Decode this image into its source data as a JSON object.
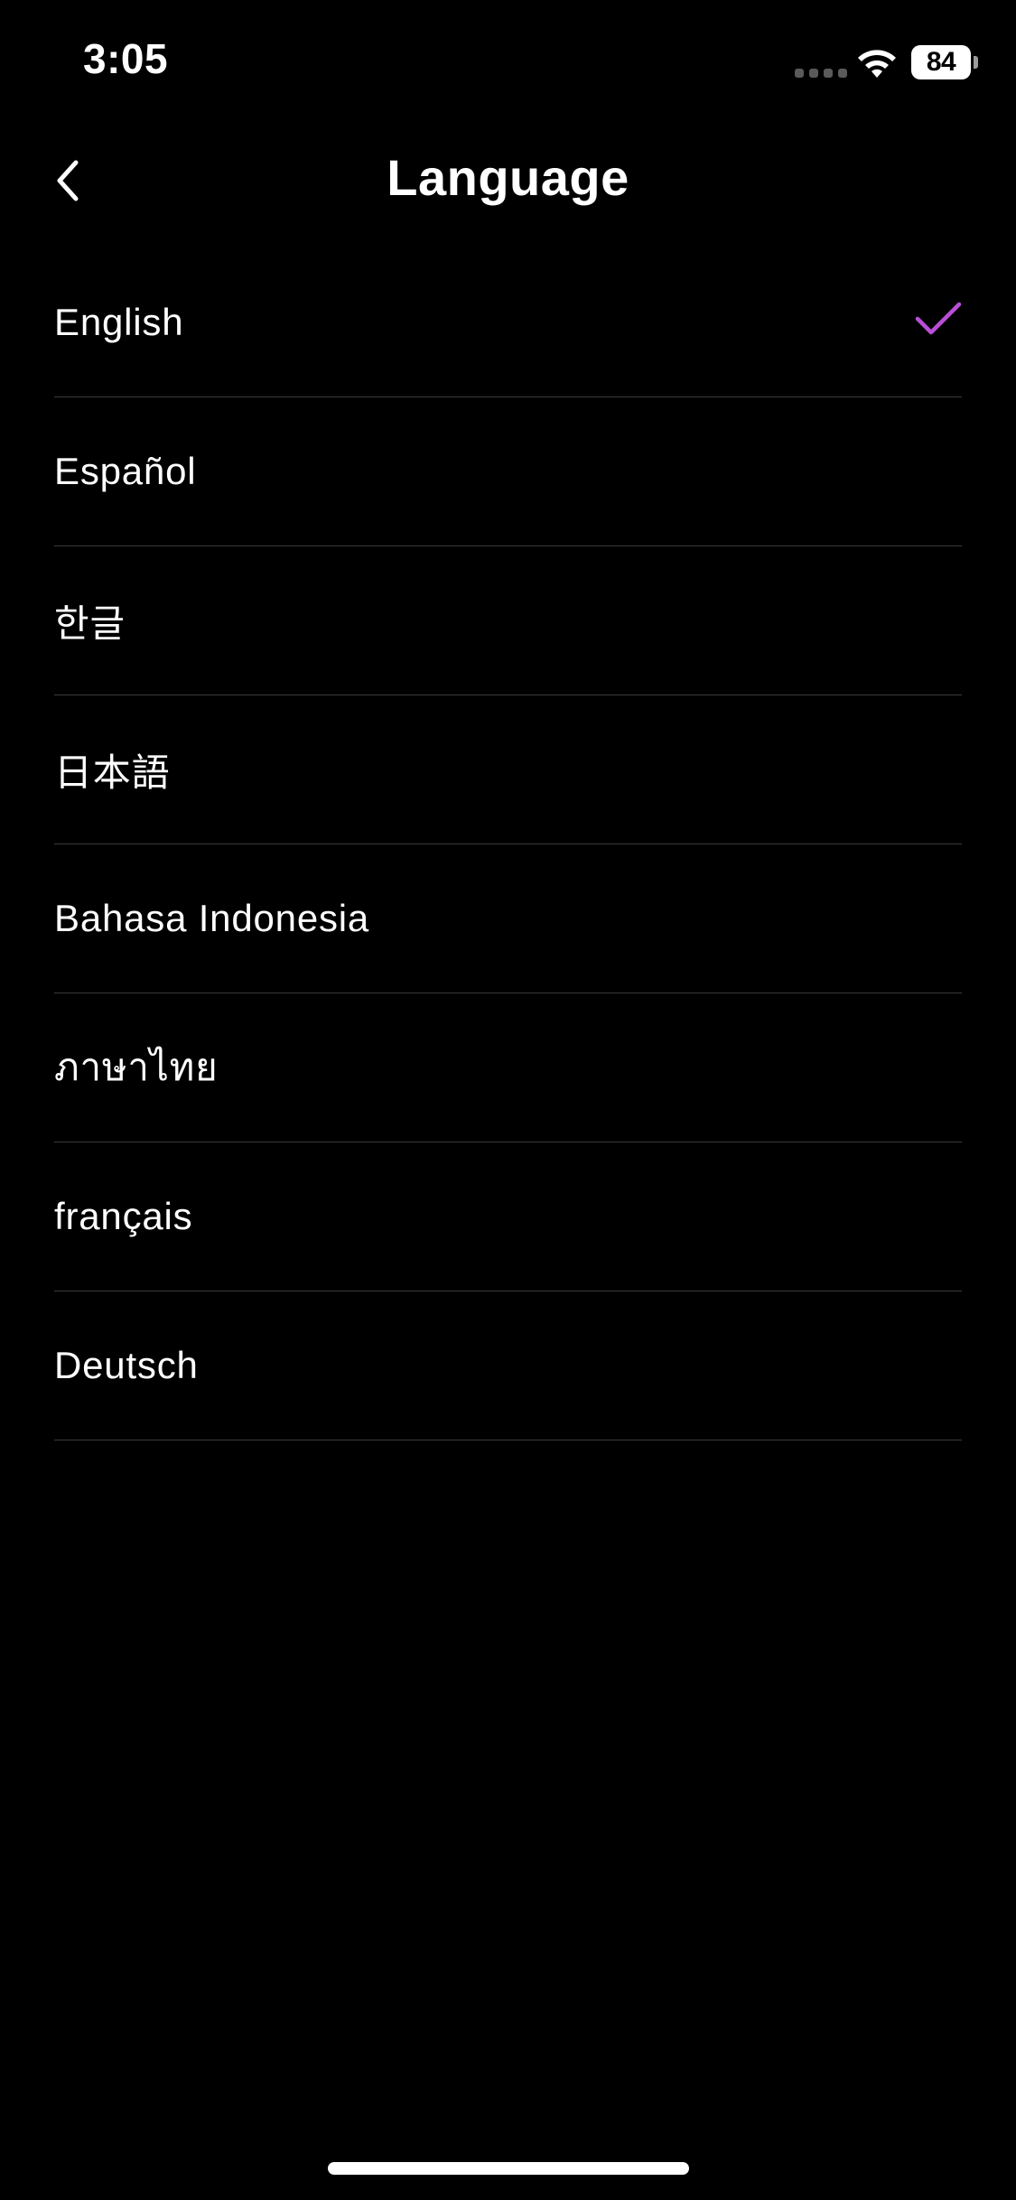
{
  "status_bar": {
    "time": "3:05",
    "battery_level": "84",
    "wifi_icon": "wifi-icon",
    "signal_icon": "cellular-signal-icon"
  },
  "header": {
    "back_icon": "chevron-left-icon",
    "title": "Language"
  },
  "languages": [
    {
      "label": "English",
      "selected": true
    },
    {
      "label": "Español",
      "selected": false
    },
    {
      "label": "한글",
      "selected": false
    },
    {
      "label": "日本語",
      "selected": false
    },
    {
      "label": "Bahasa Indonesia",
      "selected": false
    },
    {
      "label": "ภาษาไทย",
      "selected": false
    },
    {
      "label": "français",
      "selected": false
    },
    {
      "label": "Deutsch",
      "selected": false
    }
  ],
  "colors": {
    "background": "#000000",
    "text": "#ffffff",
    "divider": "#3a3a3a",
    "accent_check": "#b84fd6"
  }
}
